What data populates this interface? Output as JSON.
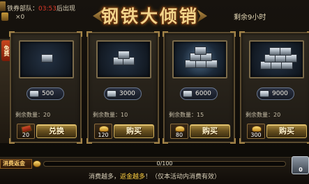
{
  "header": {
    "info_prefix": "铁券部队：",
    "info_time": "03:53",
    "info_suffix": "后出现",
    "ticket_count": "×0",
    "title": "钢铁大倾销",
    "remaining_time": "剩余9小时"
  },
  "free_tab": {
    "label": "免费"
  },
  "cards": [
    {
      "price": "500",
      "remain_label": "剩余数量：20",
      "cost": "20",
      "button_label": "兑换",
      "cost_icon": "ticket-icon",
      "glow": false
    },
    {
      "price": "3000",
      "remain_label": "剩余数量：10",
      "cost": "120",
      "button_label": "购买",
      "cost_icon": "gold-ingot-icon",
      "glow": false
    },
    {
      "price": "6000",
      "remain_label": "剩余数量：15",
      "cost": "80",
      "button_label": "购买",
      "cost_icon": "gold-ingot-icon",
      "glow": true
    },
    {
      "price": "9000",
      "remain_label": "剩余数量：20",
      "cost": "300",
      "button_label": "购买",
      "cost_icon": "gold-ingot-icon",
      "glow": false
    }
  ],
  "rebate": {
    "label": "消费返金",
    "progress_text": "0/100",
    "progress": 0,
    "hint_prefix": "消费越多，",
    "hint_gold": "返金越多",
    "hint_suffix": "！（仅本活动内消费有效）",
    "chest_value": "0"
  },
  "colors": {
    "title": "#f2d48a",
    "accent_gold": "#ffd040",
    "timer_red": "#e23a2a"
  }
}
